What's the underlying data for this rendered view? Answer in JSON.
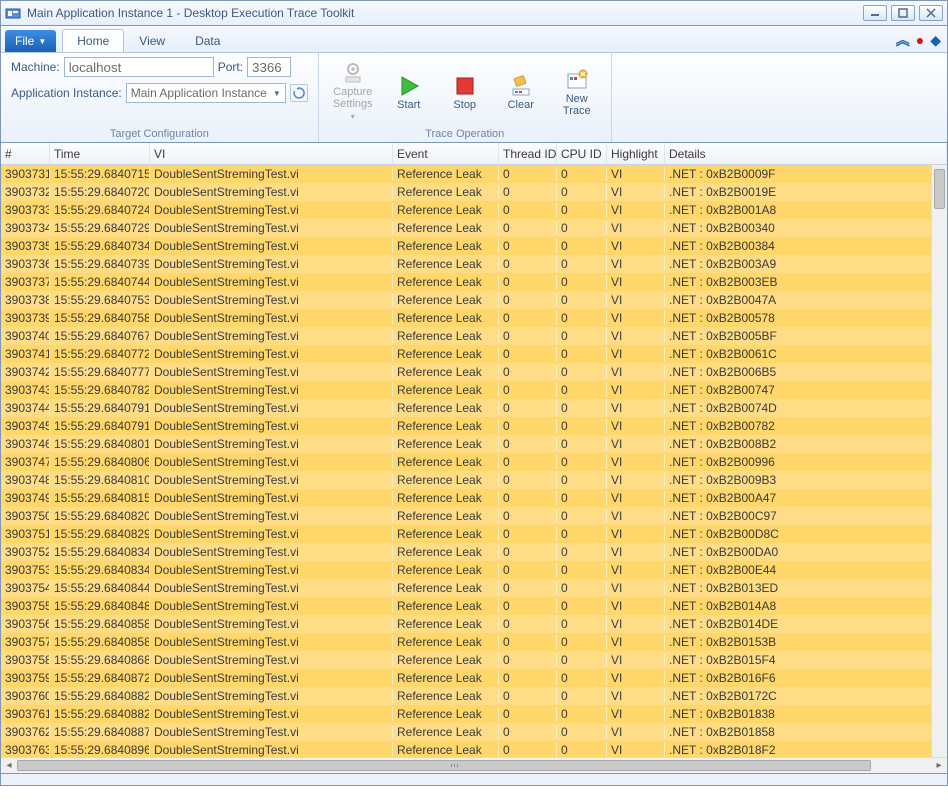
{
  "window": {
    "title": "Main Application Instance 1 - Desktop Execution Trace Toolkit"
  },
  "ribbon": {
    "file": "File",
    "tabs": {
      "home": "Home",
      "view": "View",
      "data": "Data"
    },
    "group_target": {
      "label": "Target Configuration",
      "machine_label": "Machine:",
      "machine_value": "localhost",
      "port_label": "Port:",
      "port_value": "3366",
      "appinst_label": "Application Instance:",
      "appinst_value": "Main Application Instance"
    },
    "group_trace": {
      "label": "Trace Operation",
      "capture": "Capture Settings",
      "start": "Start",
      "stop": "Stop",
      "clear": "Clear",
      "newtrace": "New Trace"
    }
  },
  "grid": {
    "headers": {
      "num": "#",
      "time": "Time",
      "vi": "VI",
      "event": "Event",
      "thread": "Thread ID",
      "cpu": "CPU ID",
      "hl": "Highlight",
      "details": "Details"
    },
    "rows": [
      {
        "num": "3903731",
        "time": "15:55:29.6840715",
        "vi": "DoubleSentStremingTest.vi",
        "event": "Reference Leak",
        "thread": "0",
        "cpu": "0",
        "hl": "VI",
        "details": ".NET : 0xB2B0009F"
      },
      {
        "num": "3903732",
        "time": "15:55:29.6840720",
        "vi": "DoubleSentStremingTest.vi",
        "event": "Reference Leak",
        "thread": "0",
        "cpu": "0",
        "hl": "VI",
        "details": ".NET : 0xB2B0019E"
      },
      {
        "num": "3903733",
        "time": "15:55:29.6840724",
        "vi": "DoubleSentStremingTest.vi",
        "event": "Reference Leak",
        "thread": "0",
        "cpu": "0",
        "hl": "VI",
        "details": ".NET : 0xB2B001A8"
      },
      {
        "num": "3903734",
        "time": "15:55:29.6840729",
        "vi": "DoubleSentStremingTest.vi",
        "event": "Reference Leak",
        "thread": "0",
        "cpu": "0",
        "hl": "VI",
        "details": ".NET : 0xB2B00340"
      },
      {
        "num": "3903735",
        "time": "15:55:29.6840734",
        "vi": "DoubleSentStremingTest.vi",
        "event": "Reference Leak",
        "thread": "0",
        "cpu": "0",
        "hl": "VI",
        "details": ".NET : 0xB2B00384"
      },
      {
        "num": "3903736",
        "time": "15:55:29.6840739",
        "vi": "DoubleSentStremingTest.vi",
        "event": "Reference Leak",
        "thread": "0",
        "cpu": "0",
        "hl": "VI",
        "details": ".NET : 0xB2B003A9"
      },
      {
        "num": "3903737",
        "time": "15:55:29.6840744",
        "vi": "DoubleSentStremingTest.vi",
        "event": "Reference Leak",
        "thread": "0",
        "cpu": "0",
        "hl": "VI",
        "details": ".NET : 0xB2B003EB"
      },
      {
        "num": "3903738",
        "time": "15:55:29.6840753",
        "vi": "DoubleSentStremingTest.vi",
        "event": "Reference Leak",
        "thread": "0",
        "cpu": "0",
        "hl": "VI",
        "details": ".NET : 0xB2B0047A"
      },
      {
        "num": "3903739",
        "time": "15:55:29.6840758",
        "vi": "DoubleSentStremingTest.vi",
        "event": "Reference Leak",
        "thread": "0",
        "cpu": "0",
        "hl": "VI",
        "details": ".NET : 0xB2B00578"
      },
      {
        "num": "3903740",
        "time": "15:55:29.6840767",
        "vi": "DoubleSentStremingTest.vi",
        "event": "Reference Leak",
        "thread": "0",
        "cpu": "0",
        "hl": "VI",
        "details": ".NET : 0xB2B005BF"
      },
      {
        "num": "3903741",
        "time": "15:55:29.6840772",
        "vi": "DoubleSentStremingTest.vi",
        "event": "Reference Leak",
        "thread": "0",
        "cpu": "0",
        "hl": "VI",
        "details": ".NET : 0xB2B0061C"
      },
      {
        "num": "3903742",
        "time": "15:55:29.6840777",
        "vi": "DoubleSentStremingTest.vi",
        "event": "Reference Leak",
        "thread": "0",
        "cpu": "0",
        "hl": "VI",
        "details": ".NET : 0xB2B006B5"
      },
      {
        "num": "3903743",
        "time": "15:55:29.6840782",
        "vi": "DoubleSentStremingTest.vi",
        "event": "Reference Leak",
        "thread": "0",
        "cpu": "0",
        "hl": "VI",
        "details": ".NET : 0xB2B00747"
      },
      {
        "num": "3903744",
        "time": "15:55:29.6840791",
        "vi": "DoubleSentStremingTest.vi",
        "event": "Reference Leak",
        "thread": "0",
        "cpu": "0",
        "hl": "VI",
        "details": ".NET : 0xB2B0074D"
      },
      {
        "num": "3903745",
        "time": "15:55:29.6840791",
        "vi": "DoubleSentStremingTest.vi",
        "event": "Reference Leak",
        "thread": "0",
        "cpu": "0",
        "hl": "VI",
        "details": ".NET : 0xB2B00782"
      },
      {
        "num": "3903746",
        "time": "15:55:29.6840801",
        "vi": "DoubleSentStremingTest.vi",
        "event": "Reference Leak",
        "thread": "0",
        "cpu": "0",
        "hl": "VI",
        "details": ".NET : 0xB2B008B2"
      },
      {
        "num": "3903747",
        "time": "15:55:29.6840806",
        "vi": "DoubleSentStremingTest.vi",
        "event": "Reference Leak",
        "thread": "0",
        "cpu": "0",
        "hl": "VI",
        "details": ".NET : 0xB2B00996"
      },
      {
        "num": "3903748",
        "time": "15:55:29.6840810",
        "vi": "DoubleSentStremingTest.vi",
        "event": "Reference Leak",
        "thread": "0",
        "cpu": "0",
        "hl": "VI",
        "details": ".NET : 0xB2B009B3"
      },
      {
        "num": "3903749",
        "time": "15:55:29.6840815",
        "vi": "DoubleSentStremingTest.vi",
        "event": "Reference Leak",
        "thread": "0",
        "cpu": "0",
        "hl": "VI",
        "details": ".NET : 0xB2B00A47"
      },
      {
        "num": "3903750",
        "time": "15:55:29.6840820",
        "vi": "DoubleSentStremingTest.vi",
        "event": "Reference Leak",
        "thread": "0",
        "cpu": "0",
        "hl": "VI",
        "details": ".NET : 0xB2B00C97"
      },
      {
        "num": "3903751",
        "time": "15:55:29.6840829",
        "vi": "DoubleSentStremingTest.vi",
        "event": "Reference Leak",
        "thread": "0",
        "cpu": "0",
        "hl": "VI",
        "details": ".NET : 0xB2B00D8C"
      },
      {
        "num": "3903752",
        "time": "15:55:29.6840834",
        "vi": "DoubleSentStremingTest.vi",
        "event": "Reference Leak",
        "thread": "0",
        "cpu": "0",
        "hl": "VI",
        "details": ".NET : 0xB2B00DA0"
      },
      {
        "num": "3903753",
        "time": "15:55:29.6840834",
        "vi": "DoubleSentStremingTest.vi",
        "event": "Reference Leak",
        "thread": "0",
        "cpu": "0",
        "hl": "VI",
        "details": ".NET : 0xB2B00E44"
      },
      {
        "num": "3903754",
        "time": "15:55:29.6840844",
        "vi": "DoubleSentStremingTest.vi",
        "event": "Reference Leak",
        "thread": "0",
        "cpu": "0",
        "hl": "VI",
        "details": ".NET : 0xB2B013ED"
      },
      {
        "num": "3903755",
        "time": "15:55:29.6840848",
        "vi": "DoubleSentStremingTest.vi",
        "event": "Reference Leak",
        "thread": "0",
        "cpu": "0",
        "hl": "VI",
        "details": ".NET : 0xB2B014A8"
      },
      {
        "num": "3903756",
        "time": "15:55:29.6840858",
        "vi": "DoubleSentStremingTest.vi",
        "event": "Reference Leak",
        "thread": "0",
        "cpu": "0",
        "hl": "VI",
        "details": ".NET : 0xB2B014DE"
      },
      {
        "num": "3903757",
        "time": "15:55:29.6840858",
        "vi": "DoubleSentStremingTest.vi",
        "event": "Reference Leak",
        "thread": "0",
        "cpu": "0",
        "hl": "VI",
        "details": ".NET : 0xB2B0153B"
      },
      {
        "num": "3903758",
        "time": "15:55:29.6840868",
        "vi": "DoubleSentStremingTest.vi",
        "event": "Reference Leak",
        "thread": "0",
        "cpu": "0",
        "hl": "VI",
        "details": ".NET : 0xB2B015F4"
      },
      {
        "num": "3903759",
        "time": "15:55:29.6840872",
        "vi": "DoubleSentStremingTest.vi",
        "event": "Reference Leak",
        "thread": "0",
        "cpu": "0",
        "hl": "VI",
        "details": ".NET : 0xB2B016F6"
      },
      {
        "num": "3903760",
        "time": "15:55:29.6840882",
        "vi": "DoubleSentStremingTest.vi",
        "event": "Reference Leak",
        "thread": "0",
        "cpu": "0",
        "hl": "VI",
        "details": ".NET : 0xB2B0172C"
      },
      {
        "num": "3903761",
        "time": "15:55:29.6840882",
        "vi": "DoubleSentStremingTest.vi",
        "event": "Reference Leak",
        "thread": "0",
        "cpu": "0",
        "hl": "VI",
        "details": ".NET : 0xB2B01838"
      },
      {
        "num": "3903762",
        "time": "15:55:29.6840887",
        "vi": "DoubleSentStremingTest.vi",
        "event": "Reference Leak",
        "thread": "0",
        "cpu": "0",
        "hl": "VI",
        "details": ".NET : 0xB2B01858"
      },
      {
        "num": "3903763",
        "time": "15:55:29.6840896",
        "vi": "DoubleSentStremingTest.vi",
        "event": "Reference Leak",
        "thread": "0",
        "cpu": "0",
        "hl": "VI",
        "details": ".NET : 0xB2B018F2"
      }
    ]
  }
}
